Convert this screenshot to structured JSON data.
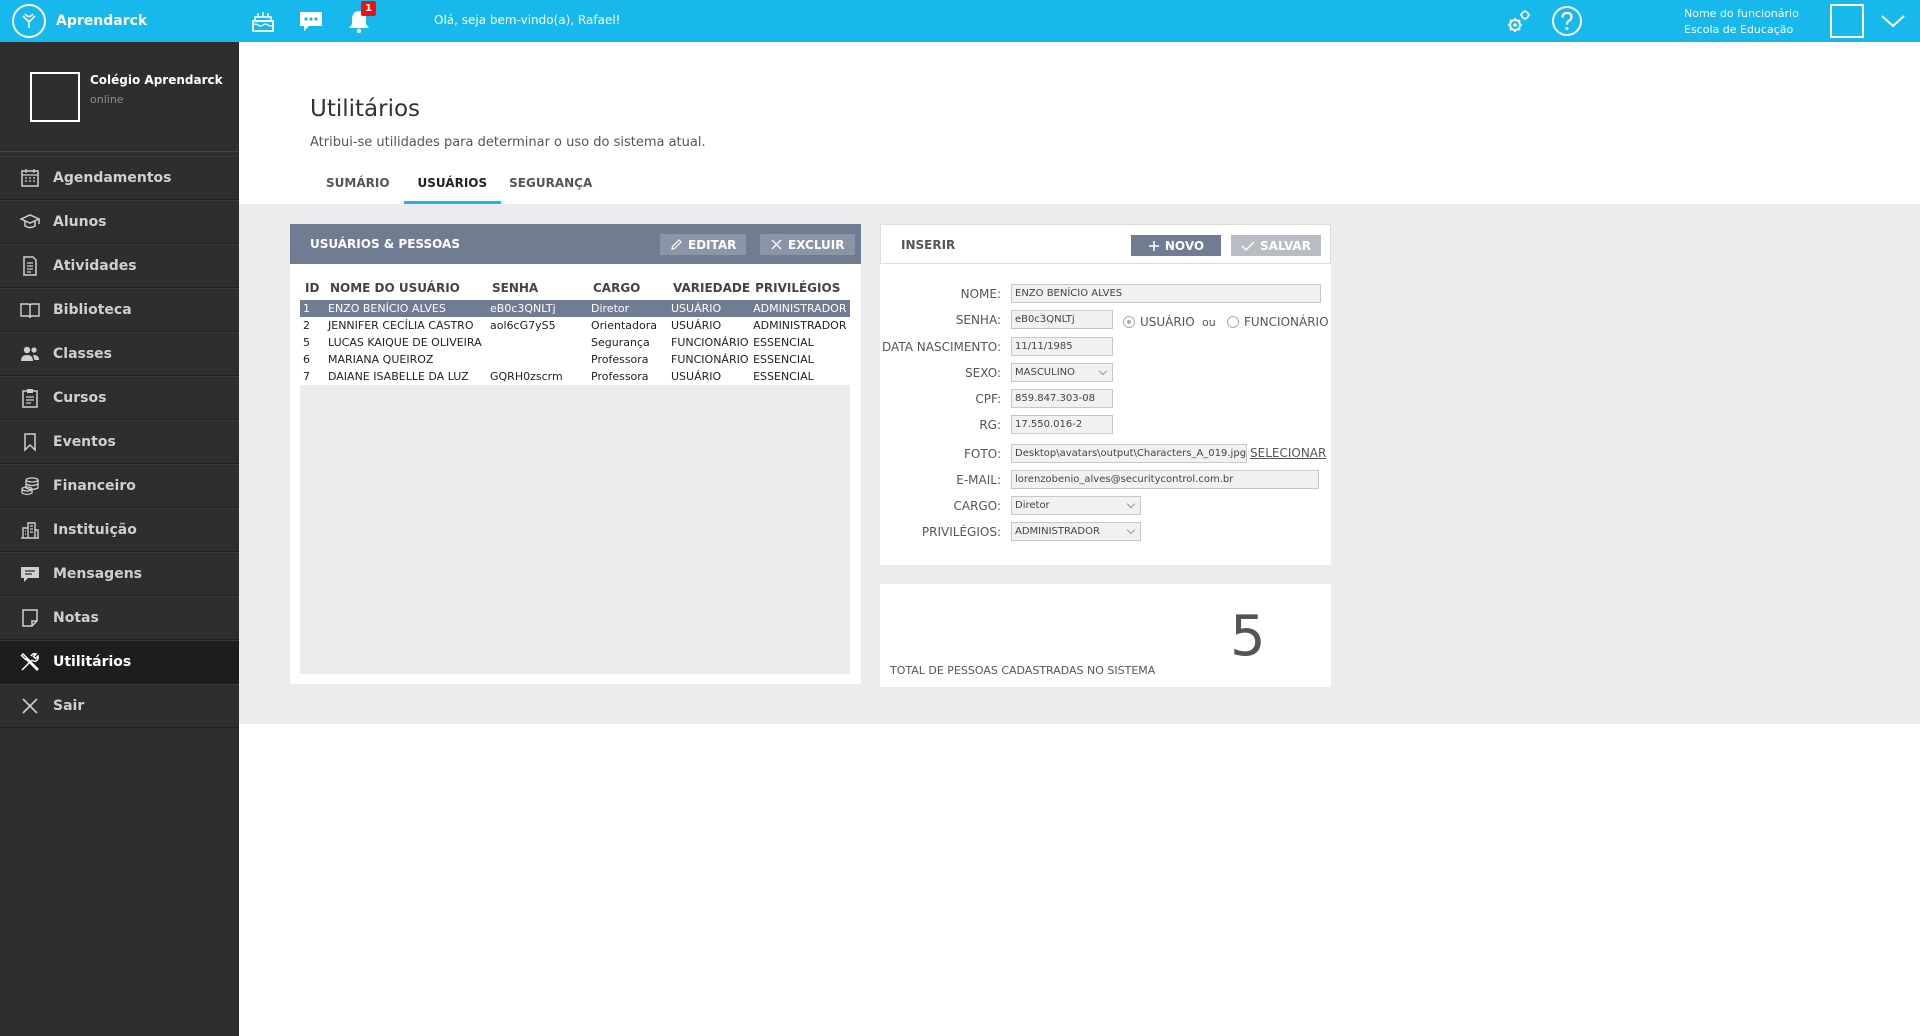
{
  "header": {
    "brand": "Aprendarck",
    "notifications_count": "1",
    "welcome": "Olá, seja bem-vindo(a), Rafael!",
    "user_line1": "Nome do funcionário",
    "user_line2": "Escola de Educação",
    "accent_color": "#17b9ec"
  },
  "sidebar": {
    "org_name": "Colégio Aprendarck",
    "org_status": "online",
    "items": [
      {
        "label": "Agendamentos",
        "icon": "calendar-icon"
      },
      {
        "label": "Alunos",
        "icon": "graduation-cap-icon"
      },
      {
        "label": "Atividades",
        "icon": "document-icon"
      },
      {
        "label": "Biblioteca",
        "icon": "book-icon"
      },
      {
        "label": "Classes",
        "icon": "users-icon"
      },
      {
        "label": "Cursos",
        "icon": "clipboard-icon"
      },
      {
        "label": "Eventos",
        "icon": "bookmark-icon"
      },
      {
        "label": "Financeiro",
        "icon": "coins-icon"
      },
      {
        "label": "Instituição",
        "icon": "building-icon"
      },
      {
        "label": "Mensagens",
        "icon": "chat-icon"
      },
      {
        "label": "Notas",
        "icon": "note-icon"
      },
      {
        "label": "Utilitários",
        "icon": "tools-icon"
      },
      {
        "label": "Sair",
        "icon": "close-icon"
      }
    ]
  },
  "page": {
    "title": "Utilitários",
    "subtitle": "Atribui-se utilidades para determinar o uso do sistema atual.",
    "tabs": [
      {
        "label": "SUMÁRIO"
      },
      {
        "label": "USUÁRIOS"
      },
      {
        "label": "SEGURANÇA"
      }
    ]
  },
  "users_panel": {
    "title": "USUÁRIOS & PESSOAS",
    "edit_label": "EDITAR",
    "delete_label": "EXCLUIR",
    "columns": [
      "ID",
      "NOME DO USUÁRIO",
      "SENHA",
      "CARGO",
      "VARIEDADE",
      "PRIVILÉGIOS"
    ],
    "rows": [
      {
        "id": "1",
        "name": "ENZO BENÍCIO ALVES",
        "password": "eB0c3QNLTj",
        "role": "Diretor",
        "variety": "USUÁRIO",
        "privileges": "ADMINISTRADOR"
      },
      {
        "id": "2",
        "name": "JENNIFER CECÍLIA CASTRO",
        "password": "aol6cG7yS5",
        "role": "Orientadora",
        "variety": "USUÁRIO",
        "privileges": "ADMINISTRADOR"
      },
      {
        "id": "5",
        "name": "LUCAS KAIQUE DE OLIVEIRA",
        "password": "",
        "role": "Segurança",
        "variety": "FUNCIONÁRIO",
        "privileges": "ESSENCIAL"
      },
      {
        "id": "6",
        "name": "MARIANA QUEIROZ",
        "password": "",
        "role": "Professora",
        "variety": "FUNCIONÁRIO",
        "privileges": "ESSENCIAL"
      },
      {
        "id": "7",
        "name": "DAIANE ISABELLE DA LUZ",
        "password": "GQRH0zscrm",
        "role": "Professora",
        "variety": "USUÁRIO",
        "privileges": "ESSENCIAL"
      }
    ]
  },
  "insert_panel": {
    "title": "INSERIR",
    "new_label": "NOVO",
    "save_label": "SALVAR",
    "labels": {
      "name": "NOME:",
      "password": "SENHA:",
      "birth": "DATA NASCIMENTO:",
      "sex": "SEXO:",
      "cpf": "CPF:",
      "rg": "RG:",
      "photo": "FOTO:",
      "email": "E-MAIL:",
      "role": "CARGO:",
      "privileges": "PRIVILÉGIOS:"
    },
    "values": {
      "name": "ENZO BENÍCIO ALVES",
      "password": "eB0c3QNLTj",
      "birth": "11/11/1985",
      "sex": "MASCULINO",
      "cpf": "859.847.303-08",
      "rg": "17.550.016-2",
      "photo": "Desktop\\avatars\\output\\Characters_A_019.jpg",
      "email": "lorenzobenio_alves@securitycontrol.com.br",
      "role": "Diretor",
      "privileges": "ADMINISTRADOR"
    },
    "radio_user": "USUÁRIO",
    "radio_or": "ou",
    "radio_employee": "FUNCIONÁRIO",
    "select_link": "SELECIONAR"
  },
  "stats": {
    "label": "TOTAL DE PESSOAS CADASTRADAS NO SISTEMA",
    "value": "5"
  }
}
